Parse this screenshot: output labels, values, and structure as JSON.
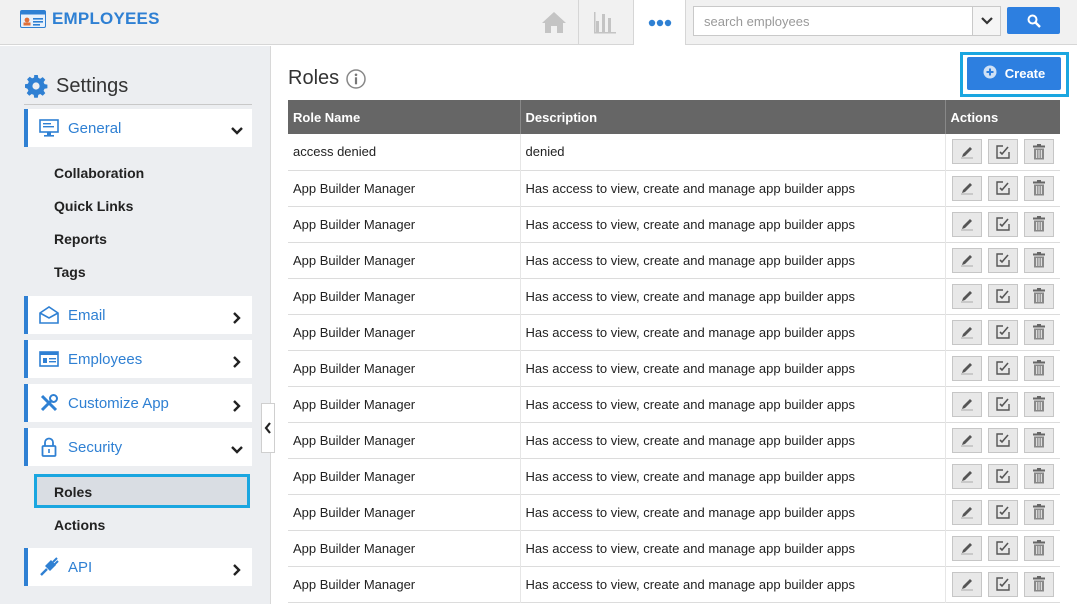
{
  "app": {
    "title": "EMPLOYEES"
  },
  "topbar": {
    "icons": [
      "home-icon",
      "analytics-icon",
      "more-icon"
    ],
    "search": {
      "placeholder": "search employees",
      "value": ""
    }
  },
  "sidebar": {
    "heading": "Settings",
    "general": {
      "label": "General",
      "subitems": [
        "Collaboration",
        "Quick Links",
        "Reports",
        "Tags"
      ]
    },
    "email": {
      "label": "Email"
    },
    "employees": {
      "label": "Employees"
    },
    "customize": {
      "label": "Customize App"
    },
    "security": {
      "label": "Security",
      "subitems": [
        "Roles",
        "Actions"
      ]
    },
    "api": {
      "label": "API"
    }
  },
  "main": {
    "title": "Roles",
    "create_label": "Create",
    "columns": [
      "Role Name",
      "Description",
      "Actions"
    ],
    "rows": [
      {
        "name": "access denied",
        "description": "denied"
      },
      {
        "name": "App Builder Manager",
        "description": "Has access to view, create and manage app builder apps"
      },
      {
        "name": "App Builder Manager",
        "description": "Has access to view, create and manage app builder apps"
      },
      {
        "name": "App Builder Manager",
        "description": "Has access to view, create and manage app builder apps"
      },
      {
        "name": "App Builder Manager",
        "description": "Has access to view, create and manage app builder apps"
      },
      {
        "name": "App Builder Manager",
        "description": "Has access to view, create and manage app builder apps"
      },
      {
        "name": "App Builder Manager",
        "description": "Has access to view, create and manage app builder apps"
      },
      {
        "name": "App Builder Manager",
        "description": "Has access to view, create and manage app builder apps"
      },
      {
        "name": "App Builder Manager",
        "description": "Has access to view, create and manage app builder apps"
      },
      {
        "name": "App Builder Manager",
        "description": "Has access to view, create and manage app builder apps"
      },
      {
        "name": "App Builder Manager",
        "description": "Has access to view, create and manage app builder apps"
      },
      {
        "name": "App Builder Manager",
        "description": "Has access to view, create and manage app builder apps"
      },
      {
        "name": "App Builder Manager",
        "description": "Has access to view, create and manage app builder apps"
      }
    ],
    "row_actions": [
      "edit-icon",
      "permissions-icon",
      "delete-icon"
    ]
  },
  "colors": {
    "accent": "#2f80d3",
    "button": "#2d7fe0",
    "highlight": "#1aa6e0",
    "header": "#666666"
  }
}
